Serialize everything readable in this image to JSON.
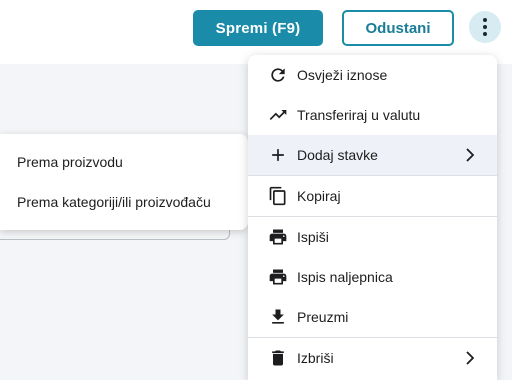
{
  "toolbar": {
    "save_label": "Spremi (F9)",
    "cancel_label": "Odustani",
    "colors": {
      "primary": "#1a8ca9",
      "more_bg": "#d6ecf2"
    }
  },
  "menu": {
    "items": [
      {
        "label": "Osvježi iznose",
        "icon": "refresh-icon"
      },
      {
        "label": "Transferiraj u valutu",
        "icon": "trending-up-icon"
      },
      {
        "label": "Dodaj stavke",
        "icon": "plus-icon",
        "has_submenu": true,
        "active": true
      },
      {
        "label": "Kopiraj",
        "icon": "copy-icon"
      },
      {
        "label": "Ispiši",
        "icon": "printer-icon"
      },
      {
        "label": "Ispis naljepnica",
        "icon": "printer-icon"
      },
      {
        "label": "Preuzmi",
        "icon": "download-icon"
      },
      {
        "label": "Izbriši",
        "icon": "trash-icon",
        "has_submenu": true
      }
    ]
  },
  "submenu": {
    "items": [
      {
        "label": "Prema proizvodu"
      },
      {
        "label": "Prema kategoriji/ili proizvođaču"
      }
    ]
  }
}
